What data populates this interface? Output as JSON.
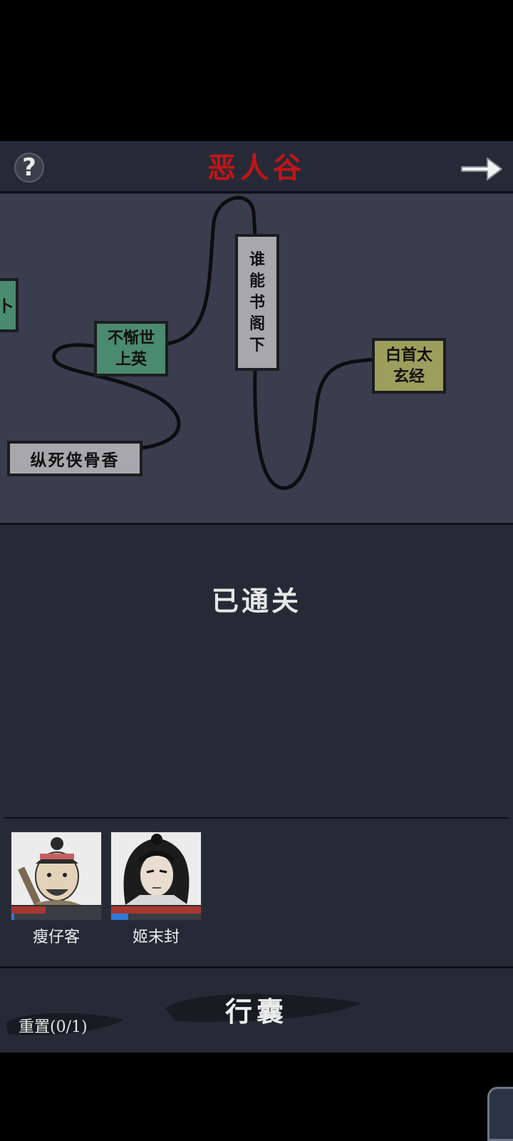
{
  "header": {
    "help_label": "?",
    "title": "恶人谷",
    "next_icon": "arrow-right-icon"
  },
  "map": {
    "nodes": [
      {
        "id": "partial",
        "label": "卜",
        "color": "green"
      },
      {
        "id": "busi",
        "label": "不惭世上英",
        "color": "green"
      },
      {
        "id": "shui",
        "label": "谁能书阁下",
        "color": "gray"
      },
      {
        "id": "baishou",
        "label": "白首太玄经",
        "color": "olive"
      },
      {
        "id": "zongsi",
        "label": "纵死侠骨香",
        "color": "gray"
      }
    ]
  },
  "status": "已通关",
  "party": [
    {
      "name": "瘦仔客",
      "hp_percent": 38,
      "mp_percent": 3
    },
    {
      "name": "姬末封",
      "hp_percent": 100,
      "mp_percent": 19
    }
  ],
  "footer": {
    "bag_label": "行囊",
    "reset_label": "重置(0/1)"
  },
  "colors": {
    "title_red": "#c41418",
    "panel_bg": "#262a37",
    "map_bg": "#393d4e",
    "hp_red": "#a8372f",
    "mp_blue": "#2f7ad8"
  }
}
